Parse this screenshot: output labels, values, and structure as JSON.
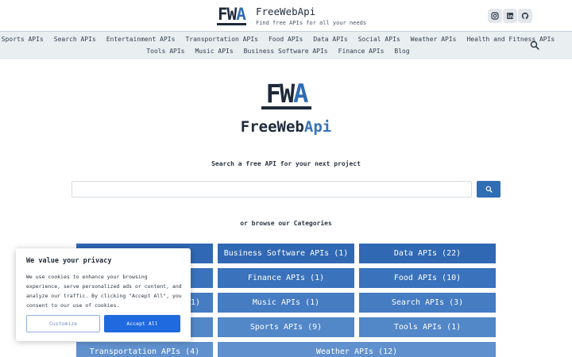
{
  "header": {
    "logo_prefix": "FW",
    "logo_suffix": "A",
    "site_title": "FreeWebApi",
    "tagline": "Find free APIs for all your needs",
    "social_icons": [
      "instagram-icon",
      "linkedin-icon",
      "github-icon"
    ]
  },
  "nav": {
    "row1": [
      "Sports APIs",
      "Search APIs",
      "Entertainment APIs",
      "Transportation APIs",
      "Food APIs",
      "Data APIs",
      "Social APIs",
      "Weather APIs",
      "Health and Fitness APIs"
    ],
    "row2": [
      "Tools APIs",
      "Music APIs",
      "Business Software APIs",
      "Finance APIs",
      "Blog"
    ]
  },
  "hero": {
    "logo_prefix": "FW",
    "logo_suffix": "A",
    "title_prefix": "FreeWeb",
    "title_suffix": "Api"
  },
  "search": {
    "label": "Search a free API for your next project",
    "value": "",
    "placeholder": ""
  },
  "browse": {
    "label": "or browse our Categories"
  },
  "categories": {
    "c1": "Business Software APIs (1)",
    "c2": "Data APIs (22)",
    "c3": "Finance APIs (1)",
    "c4": "Food APIs (10)",
    "c5": "1)",
    "c6": "Music APIs (1)",
    "c7": "Search APIs (3)",
    "c8": "Sports APIs (9)",
    "c9": "Tools APIs (1)",
    "c10": "Transportation APIs (4)",
    "c11": "Weather APIs (12)"
  },
  "cookie": {
    "title": "We value your privacy",
    "text": "We use cookies to enhance your browsing experience, serve personalized ads or content, and analyze our traffic. By clicking \"Accept All\", you consent to our use of cookies.",
    "customize": "Customize",
    "accept": "Accept All"
  },
  "colors": {
    "brand_dark": "#1e2a3a",
    "brand_blue": "#2f6db5",
    "accept_blue": "#1f6adf",
    "nav_bg": "#e9eef1"
  }
}
